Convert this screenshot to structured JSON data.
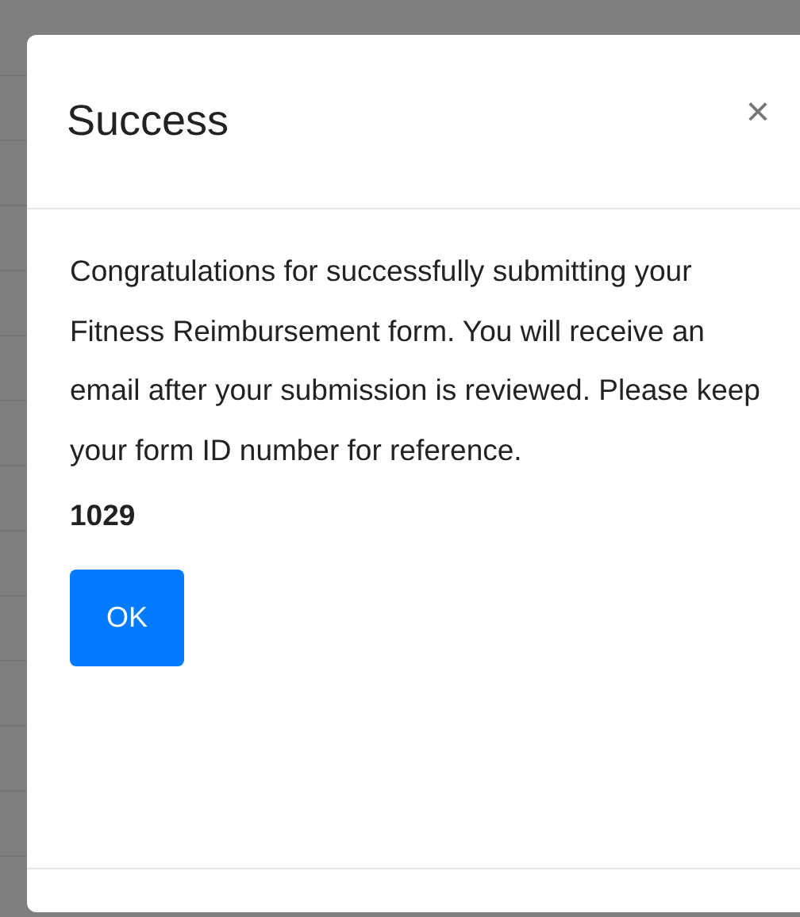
{
  "dialog": {
    "title": "Success",
    "close": "×",
    "message": "Congratulations for successfully submitting your Fitness Reimbursement form. You will receive an email after your submission is reviewed. Please keep your form ID number for reference.",
    "form_id": "1029",
    "button": "OK"
  }
}
